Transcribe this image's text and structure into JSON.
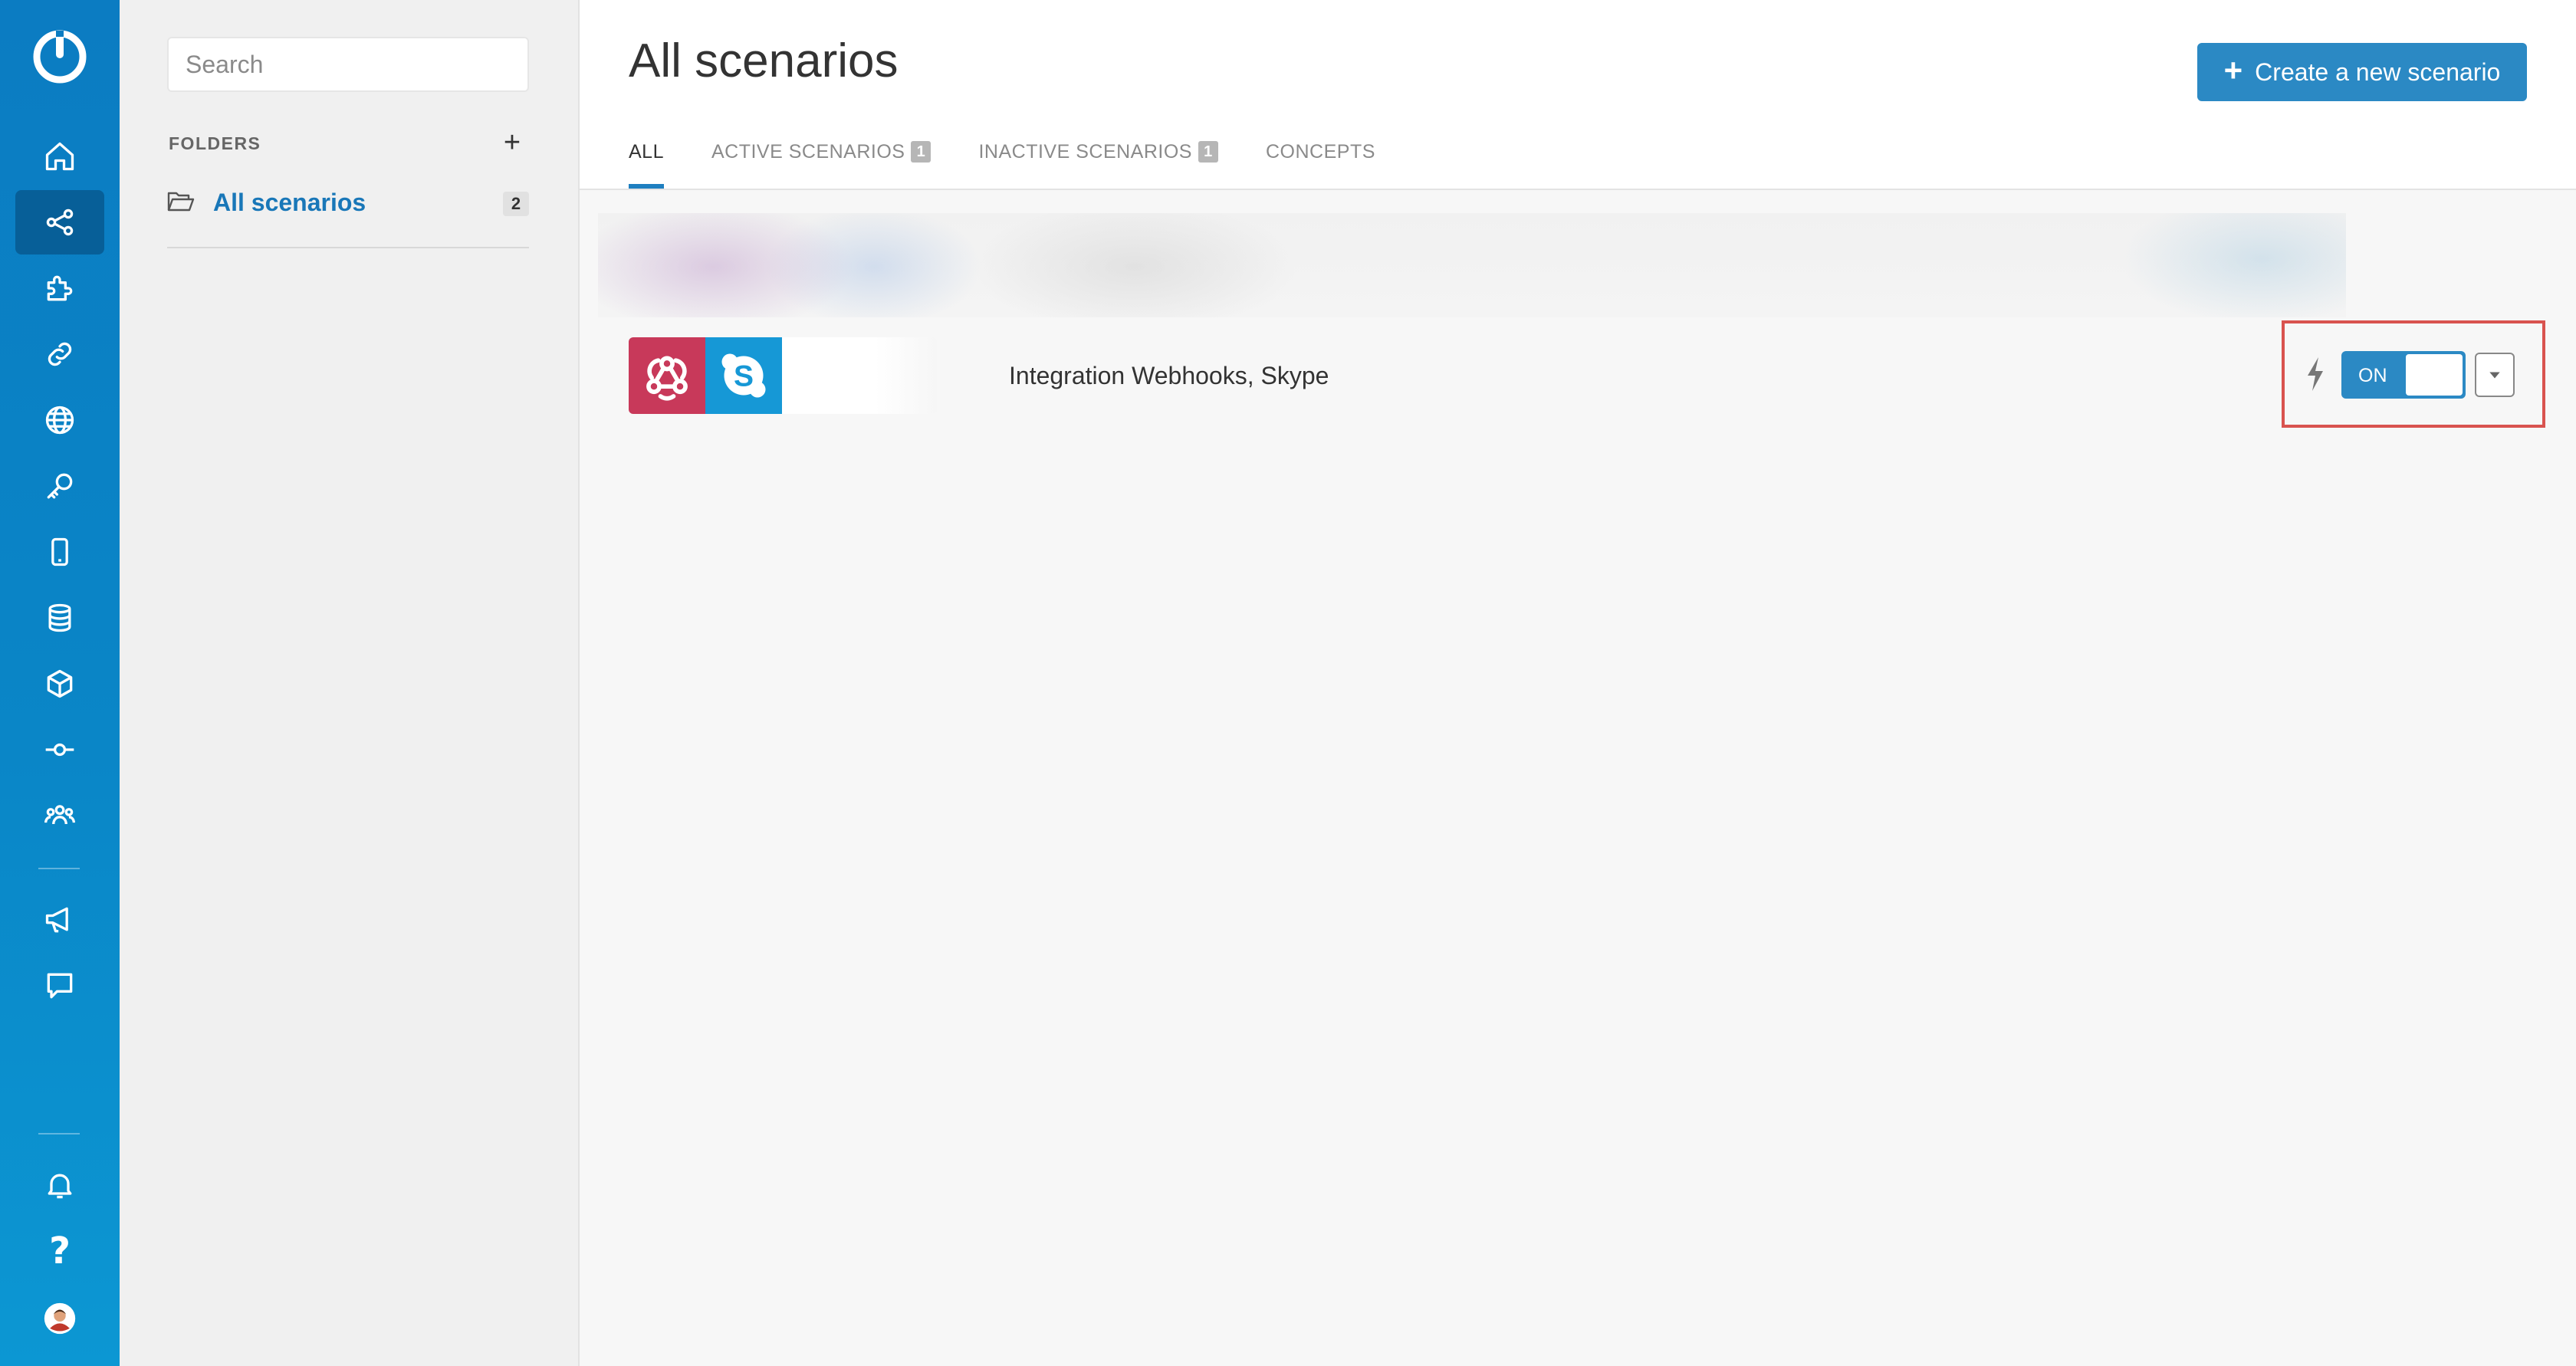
{
  "sidebar": {
    "logo": "make-logo",
    "items": [
      {
        "icon": "home-icon"
      },
      {
        "icon": "scenarios-share-icon",
        "active": true
      },
      {
        "icon": "puzzle-icon"
      },
      {
        "icon": "link-icon"
      },
      {
        "icon": "globe-icon"
      },
      {
        "icon": "key-icon"
      },
      {
        "icon": "mobile-device-icon"
      },
      {
        "icon": "database-icon"
      },
      {
        "icon": "cube-icon"
      },
      {
        "icon": "flow-node-icon"
      },
      {
        "icon": "team-icon"
      },
      {
        "icon": "megaphone-icon"
      },
      {
        "icon": "chat-icon"
      },
      {
        "icon": "bell-icon"
      },
      {
        "icon": "help-icon"
      },
      {
        "icon": "avatar"
      }
    ],
    "help_glyph": "?"
  },
  "folders": {
    "search_placeholder": "Search",
    "heading": "FOLDERS",
    "add_label": "+",
    "items": [
      {
        "name": "All scenarios",
        "count": "2"
      }
    ]
  },
  "header": {
    "title": "All scenarios",
    "create_button": "Create a new scenario",
    "create_plus": "+",
    "tabs": [
      {
        "label": "ALL",
        "active": true
      },
      {
        "label": "ACTIVE SCENARIOS",
        "badge": "1"
      },
      {
        "label": "INACTIVE SCENARIOS",
        "badge": "1"
      },
      {
        "label": "CONCEPTS"
      }
    ]
  },
  "scenarios": [
    {
      "name": "Integration Webhooks, Skype",
      "apps": [
        "webhooks-icon",
        "skype-icon"
      ],
      "toggle_label": "ON",
      "enabled": true
    }
  ],
  "colors": {
    "rail": "#0b7cc2",
    "accent": "#2b89c4",
    "webhooks": "#c8395a",
    "skype": "#1698d6",
    "highlight": "#d9534f"
  }
}
